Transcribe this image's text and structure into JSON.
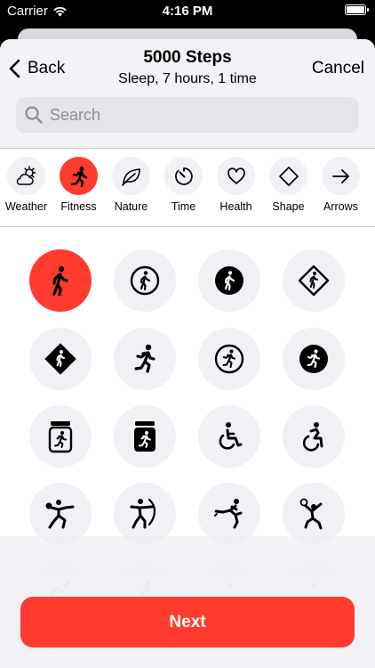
{
  "status_bar": {
    "carrier": "Carrier",
    "time": "4:16 PM"
  },
  "nav": {
    "back_label": "Back",
    "title": "5000 Steps",
    "subtitle": "Sleep, 7 hours, 1 time",
    "cancel_label": "Cancel"
  },
  "search": {
    "placeholder": "Search",
    "value": ""
  },
  "categories": [
    {
      "label": "Weather",
      "icon": "cloud-sun-icon"
    },
    {
      "label": "Fitness",
      "icon": "figure-run-icon",
      "selected": true
    },
    {
      "label": "Nature",
      "icon": "leaf-icon"
    },
    {
      "label": "Time",
      "icon": "timer-icon"
    },
    {
      "label": "Health",
      "icon": "heart-icon"
    },
    {
      "label": "Shape",
      "icon": "diamond-icon"
    },
    {
      "label": "Arrows",
      "icon": "arrow-right-icon"
    }
  ],
  "icons": [
    "figure-walk-icon",
    "figure-walk-circle-icon",
    "figure-walk-circle-fill-icon",
    "figure-walk-diamond-icon",
    "figure-walk-diamond-fill-icon",
    "figure-run-icon",
    "figure-run-circle-icon",
    "figure-run-circle-fill-icon",
    "figure-escalator-icon",
    "figure-escalator-fill-icon",
    "figure-wheelchair-icon",
    "figure-wheelchair-motion-icon",
    "figure-baseball-icon",
    "figure-archery-icon",
    "figure-kickboxing-icon",
    "figure-volleyball-icon",
    "figure-sport-partial-icon",
    "figure-sport-partial-icon",
    "figure-sport-partial-icon",
    "figure-sport-partial-icon"
  ],
  "selected_icon": "figure-walk-icon",
  "colors": {
    "accent": "#ff3b30",
    "bubble": "#f0f0f5",
    "nav_bg": "#f2f2f7"
  },
  "footer": {
    "next_label": "Next"
  }
}
